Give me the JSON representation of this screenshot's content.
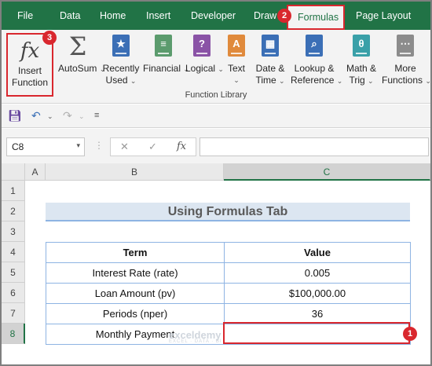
{
  "menu": {
    "tabs": [
      "File",
      "Data",
      "Home",
      "Insert",
      "Developer",
      "Draw",
      "Formulas",
      "Page Layout"
    ],
    "active": "Formulas"
  },
  "ribbon": {
    "insert_function": [
      "Insert",
      "Function"
    ],
    "buttons": [
      {
        "line1": "AutoSum",
        "line2": ""
      },
      {
        "line1": "Recently",
        "line2": "Used"
      },
      {
        "line1": "Financial",
        "line2": ""
      },
      {
        "line1": "Logical",
        "line2": ""
      },
      {
        "line1": "Text",
        "line2": ""
      },
      {
        "line1": "Date &",
        "line2": "Time"
      },
      {
        "line1": "Lookup &",
        "line2": "Reference"
      },
      {
        "line1": "Math &",
        "line2": "Trig"
      },
      {
        "line1": "More",
        "line2": "Functions"
      }
    ],
    "group_label": "Function Library"
  },
  "formula_bar": {
    "name_box": "C8",
    "fx_label": "fx",
    "formula": ""
  },
  "grid": {
    "columns": [
      "A",
      "B",
      "C"
    ],
    "rows": [
      "1",
      "2",
      "3",
      "4",
      "5",
      "6",
      "7",
      "8"
    ],
    "title": "Using Formulas Tab",
    "header": {
      "term": "Term",
      "value": "Value"
    },
    "rows_data": [
      {
        "term": "Interest Rate (rate)",
        "value": "0.005"
      },
      {
        "term": "Loan Amount (pv)",
        "value": "$100,000.00"
      },
      {
        "term": "Periods (nper)",
        "value": "36"
      },
      {
        "term": "Monthly Payment",
        "value": ""
      }
    ]
  },
  "badges": {
    "one": "1",
    "two": "2",
    "three": "3"
  },
  "watermark": {
    "name": "exceldemy",
    "tagline": "EXCEL · DATA · BI"
  },
  "colors": {
    "excel_green": "#217346",
    "highlight_red": "#d9272e",
    "table_border": "#8eb4e3",
    "title_fill": "#dce6f1"
  }
}
